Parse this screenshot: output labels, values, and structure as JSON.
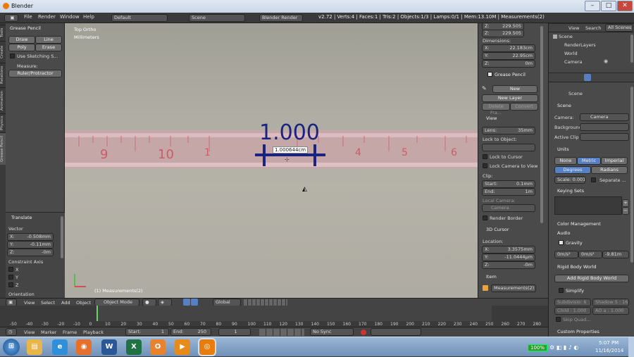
{
  "window": {
    "title": "Blender"
  },
  "menu": {
    "file": "File",
    "render": "Render",
    "window": "Window",
    "help": "Help",
    "layout": "Default",
    "scene": "Scene",
    "engine": "Blender Render",
    "stats": "v2.72 | Verts:4 | Faces:1 | Tris:2 | Objects:1/3 | Lamps:0/1 | Mem:13.10M | Measurements(2)"
  },
  "toolshelf": {
    "tabs": [
      "Tools",
      "Create",
      "Relations",
      "Animation",
      "Physics",
      "Grease Pencil"
    ],
    "panel": "Grease Pencil",
    "draw": "Draw",
    "line": "Line",
    "poly": "Poly",
    "erase": "Erase",
    "sketch": "Use Sketching S...",
    "measure_label": "Measure:",
    "ruler": "Ruler/Protractor",
    "translate": "Translate",
    "vector": "Vector",
    "vx_label": "X:",
    "vx": "-0.508mm",
    "vy_label": "Y:",
    "vy": "-0.11mm",
    "vz_label": "Z:",
    "vz": "-0m",
    "constraint": "Constraint Axis",
    "cx": "X",
    "cy": "Y",
    "cz": "Z",
    "orientation": "Orientation"
  },
  "viewport": {
    "view_name": "Top Ortho",
    "units": "Millimeters",
    "ruler_big": "1.000",
    "ruler_small": "1.000644cm",
    "object_label": "(1) Measurements(2)",
    "tape_numbers": [
      "9",
      "10",
      "1",
      "4",
      "5",
      "6"
    ]
  },
  "npanel": {
    "z_label": "Z:",
    "z_top": "229.505",
    "dimensions": "Dimensions:",
    "dx_label": "X:",
    "dx": "22.183cm",
    "dy_label": "Y:",
    "dy": "22.95cm",
    "dz_label": "Z:",
    "dz": "0m",
    "gp_header": "Grease Pencil",
    "new": "New",
    "new_layer": "New Layer",
    "delete_frame": "Delete Fra...",
    "convert": "Convert",
    "view_header": "View",
    "lens_label": "Lens:",
    "lens": "35mm",
    "lock_obj": "Lock to Object:",
    "lock_cursor": "Lock to Cursor",
    "lock_cam": "Lock Camera to View",
    "clip": "Clip:",
    "start_label": "Start:",
    "start": "0.1mm",
    "end_label": "End:",
    "end": "1m",
    "local_cam": "Local Camera:",
    "camera": "Camera",
    "render_border": "Render Border",
    "cursor_header": "3D Cursor",
    "location": "Location:",
    "lx_label": "X:",
    "lx": "3.3575mm",
    "ly_label": "Y:",
    "ly": "-11.0444μm",
    "lz_label": "Z:",
    "lz": "-0m",
    "item_header": "Item",
    "item_name": "Measurements(2)"
  },
  "outliner": {
    "view": "View",
    "search": "Search",
    "all_scenes": "All Scenes",
    "scene": "Scene",
    "render_layers": "RenderLayers",
    "world": "World",
    "camera": "Camera"
  },
  "properties": {
    "scene": "Scene",
    "scene_header": "Scene",
    "camera_label": "Camera:",
    "camera": "Camera",
    "background": "Background",
    "active_clip": "Active Clip",
    "units": "Units",
    "none": "None",
    "metric": "Metric",
    "imperial": "Imperial",
    "degrees": "Degrees",
    "radians": "Radians",
    "scale": "Scale: 0.001",
    "separate": "Separate ...",
    "keying_sets": "Keying Sets",
    "color_mgmt": "Color Management",
    "audio": "Audio",
    "gravity": "Gravity",
    "gx": "0m/s²",
    "gy": "0m/s²",
    "gz": "-9.81m",
    "rigid_world": "Rigid Body World",
    "add_rigid": "Add Rigid Body World",
    "simplify": "Simplify",
    "subdivision": "Subdivisio: 6",
    "shadow": "Shadow S : 16",
    "child": "Child : 1.000",
    "ao": "AO a : 1.000",
    "skip_quad": "Skip Quad...",
    "custom_props": "Custom Properties"
  },
  "viewheader": {
    "view": "View",
    "select": "Select",
    "add": "Add",
    "object": "Object",
    "mode": "Object Mode",
    "global": "Global"
  },
  "timeline": {
    "ticks": [
      "-50",
      "-40",
      "-30",
      "-20",
      "-10",
      "0",
      "10",
      "20",
      "30",
      "40",
      "50",
      "60",
      "70",
      "80",
      "90",
      "100",
      "110",
      "120",
      "130",
      "140",
      "150",
      "160",
      "170",
      "180",
      "190",
      "200",
      "210",
      "220",
      "230",
      "240",
      "250",
      "260",
      "270",
      "280"
    ],
    "view": "View",
    "marker": "Marker",
    "frame": "Frame",
    "playback": "Playback",
    "start": "Start:",
    "start_val": "1",
    "end": "End:",
    "end_val": "250",
    "current": "1",
    "sync": "No Sync"
  },
  "taskbar": {
    "battery": "100%",
    "time": "5:07 PM",
    "date": "11/16/2014"
  },
  "colors": {
    "accent": "#5680c2",
    "ruler": "#1a237e"
  }
}
